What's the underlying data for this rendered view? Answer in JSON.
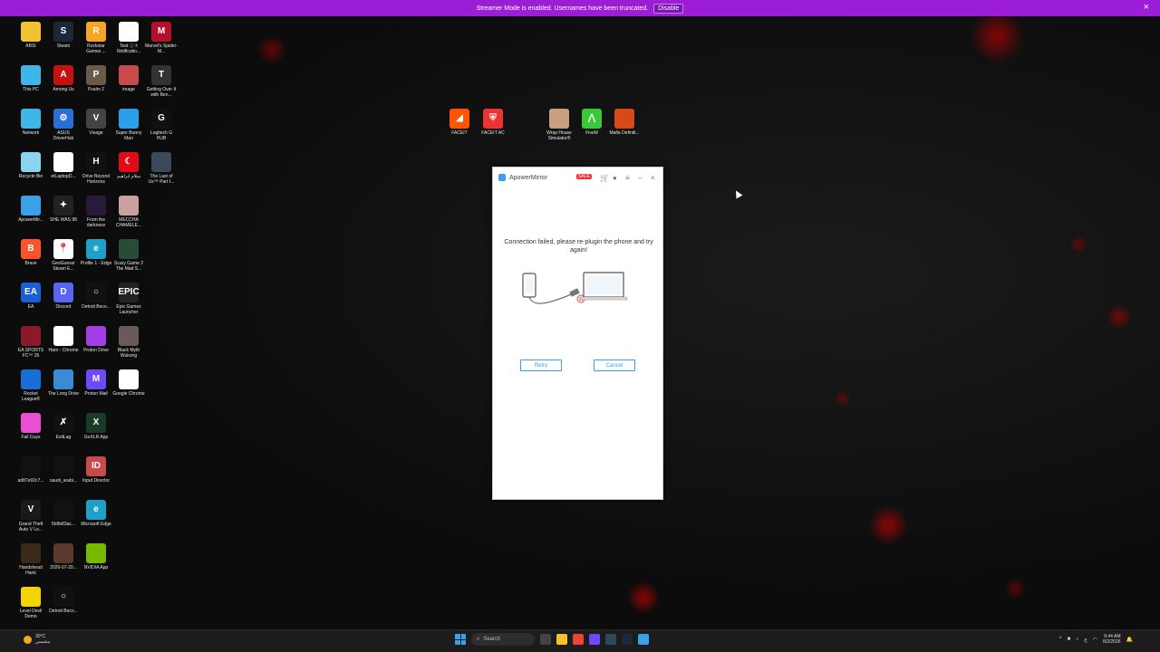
{
  "banner": {
    "text": "Streamer Mode is enabled. Usernames have been truncated.",
    "disable_label": "Disable",
    "close": "×"
  },
  "desktop_icons": [
    {
      "label": "ABSI",
      "color": "#f2c230",
      "glyph": ""
    },
    {
      "label": "Steam",
      "color": "#1b2838",
      "glyph": "S"
    },
    {
      "label": "Rockstar Games ...",
      "color": "#f5a623",
      "glyph": "R"
    },
    {
      "label": "Test ⓘ ± Notificatio...",
      "color": "#ffffff",
      "glyph": "G"
    },
    {
      "label": "Marvel's Spider-M...",
      "color": "#b3102b",
      "glyph": "M"
    },
    {
      "label": "This PC",
      "color": "#3fb6e8",
      "glyph": ""
    },
    {
      "label": "Among Us",
      "color": "#c51111",
      "glyph": "A"
    },
    {
      "label": "Psalm 2",
      "color": "#6a5a4a",
      "glyph": "P"
    },
    {
      "label": "image",
      "color": "#c94a4a",
      "glyph": ""
    },
    {
      "label": "Getting Over It with Ben...",
      "color": "#333333",
      "glyph": "T"
    },
    {
      "label": "Network",
      "color": "#3fb6e8",
      "glyph": ""
    },
    {
      "label": "ASUS DriverHub",
      "color": "#2a6fd6",
      "glyph": "⚙"
    },
    {
      "label": "Visage",
      "color": "#444444",
      "glyph": "V"
    },
    {
      "label": "Super Bunny Man",
      "color": "#2aa0e8",
      "glyph": ""
    },
    {
      "label": "Logitech G HUB",
      "color": "#111111",
      "glyph": "G"
    },
    {
      "label": "Recycle Bin",
      "color": "#8ad4f0",
      "glyph": ""
    },
    {
      "label": "etLaptopD...",
      "color": "#ffffff",
      "glyph": "G"
    },
    {
      "label": "Drive Beyond Horizons",
      "color": "#111111",
      "glyph": "H"
    },
    {
      "label": "سلام ابراهيم",
      "color": "#e30a17",
      "glyph": "☾"
    },
    {
      "label": "The Last of Us™ Part I...",
      "color": "#3a4a5a",
      "glyph": ""
    },
    {
      "label": "ApowerMir...",
      "color": "#3aa0e8",
      "glyph": ""
    },
    {
      "label": "SHE WAS 98",
      "color": "#222222",
      "glyph": "✦"
    },
    {
      "label": "From the darkness",
      "color": "#2a1a3a",
      "glyph": ""
    },
    {
      "label": "MECCHA CHAMELE...",
      "color": "#c8a0a0",
      "glyph": ""
    },
    {
      "label": "Brave",
      "color": "#fb542b",
      "glyph": "B"
    },
    {
      "label": "GeoGuessr Steam E...",
      "color": "#ffffff",
      "glyph": "📍"
    },
    {
      "label": "Profile 1 - Edge",
      "color": "#1da1c8",
      "glyph": "e"
    },
    {
      "label": "Scary Game 2 The Mad S...",
      "color": "#2a4a3a",
      "glyph": ""
    },
    {
      "label": "EA",
      "color": "#1a5fd6",
      "glyph": "EA"
    },
    {
      "label": "Discord",
      "color": "#5865f2",
      "glyph": "D"
    },
    {
      "label": "Detroit Beco...",
      "color": "#111111",
      "glyph": "○"
    },
    {
      "label": "Epic Games Launcher",
      "color": "#222222",
      "glyph": "EPIC"
    },
    {
      "label": "EA SPORTS FC™ 26",
      "color": "#8a1a2a",
      "glyph": ""
    },
    {
      "label": "Haro - Chrome",
      "color": "#ffffff",
      "glyph": "G"
    },
    {
      "label": "Proton Drive",
      "color": "#a33de8",
      "glyph": ""
    },
    {
      "label": "Black Myth Wukong",
      "color": "#6a5a5a",
      "glyph": ""
    },
    {
      "label": "Rocket League®",
      "color": "#1a6fd6",
      "glyph": ""
    },
    {
      "label": "The Long Drive",
      "color": "#3a8ad6",
      "glyph": ""
    },
    {
      "label": "Proton Mail",
      "color": "#6d4aff",
      "glyph": "M"
    },
    {
      "label": "Google Chrome",
      "color": "#ffffff",
      "glyph": "G"
    },
    {
      "label": "Fall Guys",
      "color": "#e94fd0",
      "glyph": ""
    },
    {
      "label": "ExitLag",
      "color": "#111111",
      "glyph": "✗"
    },
    {
      "label": "GoXLR App",
      "color": "#1a3a2a",
      "glyph": "X"
    },
    {
      "label": "ad87e92c7...",
      "color": "#111111",
      "glyph": ""
    },
    {
      "label": "saudi_arabi...",
      "color": "#111111",
      "glyph": ""
    },
    {
      "label": "Input Director",
      "color": "#c94a4a",
      "glyph": "ID"
    },
    {
      "label": "Grand Theft Auto V Le...",
      "color": "#1a1a1a",
      "glyph": "V"
    },
    {
      "label": "5b9b83ac...",
      "color": "#111111",
      "glyph": ""
    },
    {
      "label": "Microsoft Edge",
      "color": "#1da1c8",
      "glyph": "e"
    },
    {
      "label": "Handshead Hank",
      "color": "#3a2a1a",
      "glyph": ""
    },
    {
      "label": "2026-07-20...",
      "color": "#5a3a2a",
      "glyph": ""
    },
    {
      "label": "NVIDIA App",
      "color": "#76b900",
      "glyph": ""
    },
    {
      "label": "Level Devil Demo",
      "color": "#f2d500",
      "glyph": ""
    },
    {
      "label": "Detroit Beco...",
      "color": "#111111",
      "glyph": "○"
    }
  ],
  "top_icons": [
    {
      "label": "FACEIT",
      "color": "#ff5500",
      "glyph": "◢"
    },
    {
      "label": "FACEIT AC",
      "color": "#e33",
      "glyph": "⛨"
    },
    {
      "label": "Wrap House Simulator®",
      "color": "#c8a080",
      "glyph": ""
    },
    {
      "label": "FiveM",
      "color": "#3ac83a",
      "glyph": "⋀"
    },
    {
      "label": "Mafia Definiti...",
      "color": "#d64a1a",
      "glyph": ""
    }
  ],
  "app_window": {
    "title": "ApowerMirror",
    "sale_badge": "SALE",
    "message": "Connection failed, please re-plugin the phone and try again!",
    "retry_label": "Retry",
    "cancel_label": "Cancel",
    "minimize": "–",
    "close": "×",
    "menu": "≡",
    "accent": "#3aa0e8"
  },
  "taskbar": {
    "weather_temp": "30°C",
    "weather_desc": "مشمس",
    "search_placeholder": "Search",
    "tray_lang": "ع",
    "time": "9:44 AM",
    "date": "8/2/2026"
  }
}
